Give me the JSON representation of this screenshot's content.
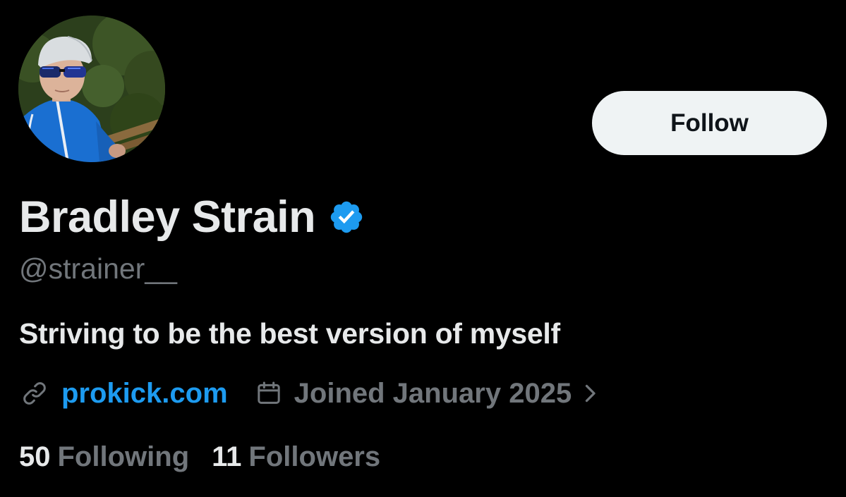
{
  "profile": {
    "display_name": "Bradley Strain",
    "verified": true,
    "handle": "@strainer__",
    "bio": "Striving to be the best version of myself",
    "website": "prokick.com",
    "joined": "Joined January 2025",
    "avatar_icon": "profile-photo"
  },
  "actions": {
    "follow_label": "Follow"
  },
  "stats": {
    "following_count": "50",
    "following_label": "Following",
    "followers_count": "11",
    "followers_label": "Followers"
  },
  "icons": {
    "verified": "verified-badge-icon",
    "link": "link-icon",
    "calendar": "calendar-icon",
    "chevron": "chevron-right-icon"
  },
  "colors": {
    "background": "#000000",
    "primary_text": "#e7e9ea",
    "secondary_text": "#71767b",
    "accent": "#1d9bf0",
    "follow_button_bg": "#eff3f4",
    "follow_button_text": "#0f1419"
  }
}
